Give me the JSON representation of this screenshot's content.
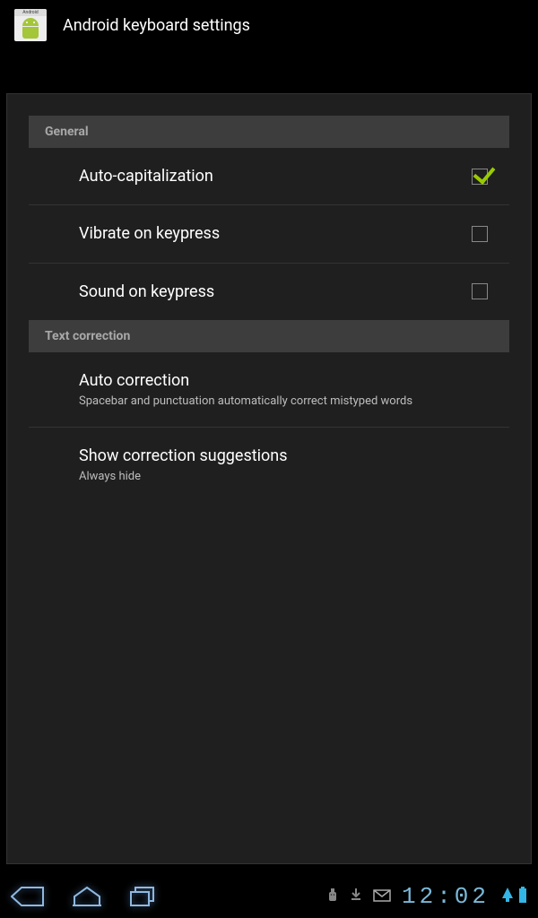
{
  "header": {
    "title": "Android keyboard settings"
  },
  "sections": {
    "general": {
      "label": "General",
      "auto_cap": {
        "title": "Auto-capitalization",
        "checked": true
      },
      "vibrate": {
        "title": "Vibrate on keypress",
        "checked": false
      },
      "sound": {
        "title": "Sound on keypress",
        "checked": false
      }
    },
    "text_correction": {
      "label": "Text correction",
      "auto_correction": {
        "title": "Auto correction",
        "subtitle": "Spacebar and punctuation automatically correct mistyped words"
      },
      "show_suggestions": {
        "title": "Show correction suggestions",
        "subtitle": "Always hide"
      }
    }
  },
  "statusbar": {
    "time": "12:02"
  }
}
